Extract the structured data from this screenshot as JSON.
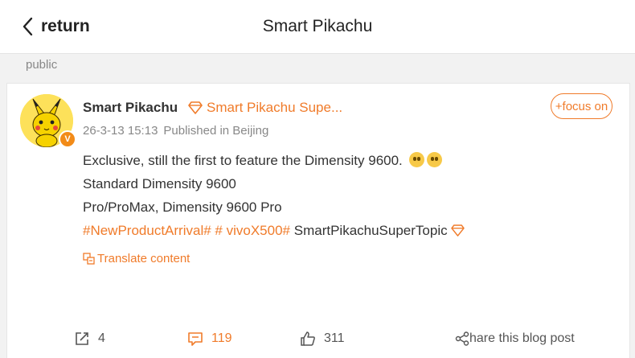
{
  "header": {
    "back_label": "return",
    "title": "Smart Pikachu"
  },
  "section_label": "public",
  "post": {
    "author": "Smart Pikachu",
    "supertopic": "Smart Pikachu Supe...",
    "follow_label": "+focus on",
    "timestamp": "26-3-13 15:13",
    "location": "Published in Beijing",
    "lines": [
      "Exclusive, still the first to feature the Dimensity 9600.",
      "Standard Dimensity 9600",
      "Pro/ProMax, Dimensity 9600 Pro"
    ],
    "hashtags": [
      "#NewProductArrival#",
      "# vivoX500#"
    ],
    "supertopic_link": "SmartPikachuSuperTopic",
    "translate_label": "Translate content",
    "verified_mark": "V"
  },
  "actions": {
    "share_count": "4",
    "comment_count": "119",
    "like_count": "311",
    "share_blog_label": "hare this blog post"
  },
  "colors": {
    "accent": "#f07b2a",
    "background": "#f2f2f2",
    "text": "#333333",
    "muted": "#888888"
  },
  "icons": {
    "back": "chevron-left-icon",
    "supertopic": "diamond-icon",
    "translate": "translate-icon",
    "repost": "repost-icon",
    "comment": "comment-icon",
    "like": "thumbs-up-icon",
    "share": "share-icon"
  }
}
